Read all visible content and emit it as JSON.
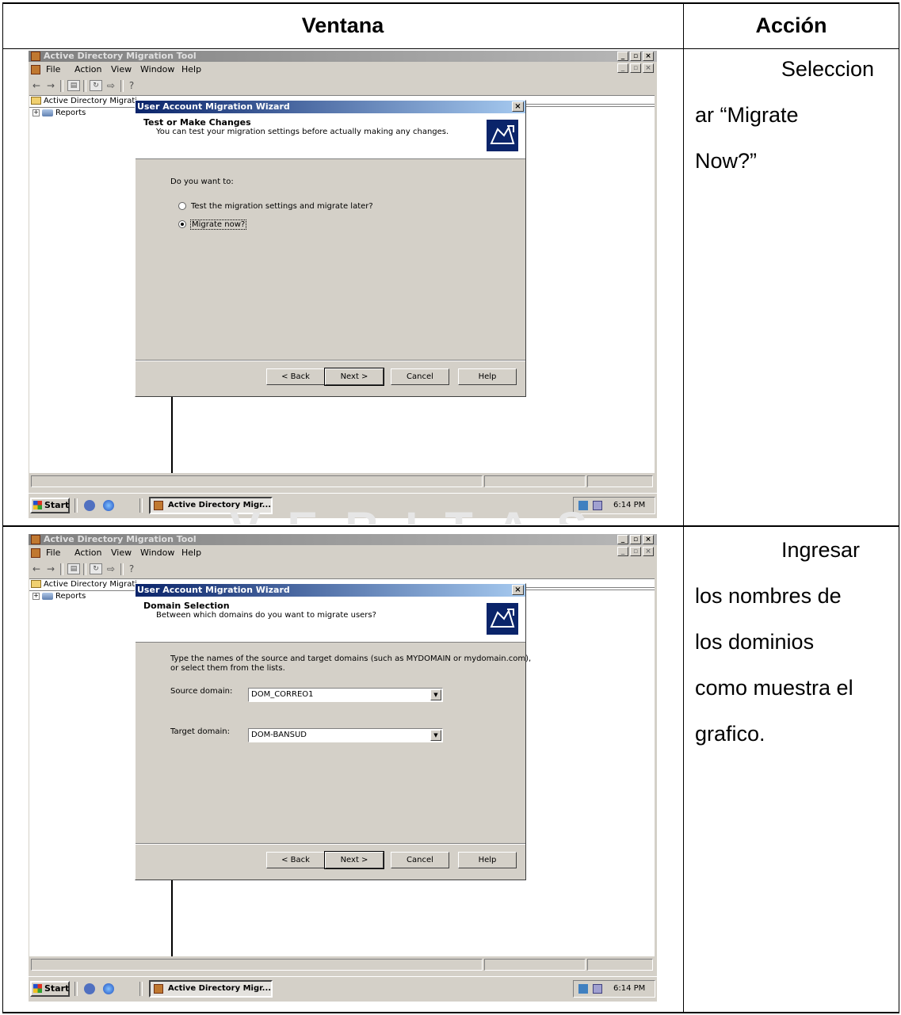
{
  "table": {
    "col_ventana": "Ventana",
    "col_accion": "Acción"
  },
  "rows": [
    {
      "accion": [
        "Seleccion",
        "ar “Migrate",
        "Now?”"
      ],
      "screen": {
        "window_title": "Active Directory Migration Tool",
        "menu": [
          "File",
          "Action",
          "View",
          "Window",
          "Help"
        ],
        "tree_root": "Active Directory Migrati",
        "tree_item": "Reports",
        "wizard_title": "User Account Migration Wizard",
        "header_title": "Test or Make Changes",
        "header_subtitle": "You can test your migration settings before actually making any changes.",
        "prompt": "Do you want to:",
        "options": [
          {
            "label": "Test the migration settings and migrate later?",
            "selected": false
          },
          {
            "label": "Migrate now?",
            "selected": true
          }
        ],
        "buttons": {
          "back": "< Back",
          "next": "Next >",
          "cancel": "Cancel",
          "help": "Help"
        },
        "taskbar": {
          "start": "Start",
          "task": "Active Directory Migr...",
          "clock": "6:14 PM"
        }
      }
    },
    {
      "accion": [
        "Ingresar",
        "los nombres de",
        "los dominios",
        "como muestra el",
        "grafico."
      ],
      "screen": {
        "window_title": "Active Directory Migration Tool",
        "menu": [
          "File",
          "Action",
          "View",
          "Window",
          "Help"
        ],
        "tree_root": "Active Directory Migrati",
        "tree_item": "Reports",
        "wizard_title": "User Account Migration Wizard",
        "header_title": "Domain Selection",
        "header_subtitle": "Between which domains do you want to migrate users?",
        "instructions_1": "Type the names of the source and target domains (such as MYDOMAIN or mydomain.com),",
        "instructions_2": "or select them from the lists.",
        "source_label": "Source domain:",
        "source_value": "DOM_CORREO1",
        "target_label": "Target domain:",
        "target_value": "DOM-BANSUD",
        "buttons": {
          "back": "< Back",
          "next": "Next >",
          "cancel": "Cancel",
          "help": "Help"
        },
        "taskbar": {
          "start": "Start",
          "task": "Active Directory Migr...",
          "clock": "6:14 PM"
        }
      }
    }
  ],
  "watermark": "VERITAS"
}
